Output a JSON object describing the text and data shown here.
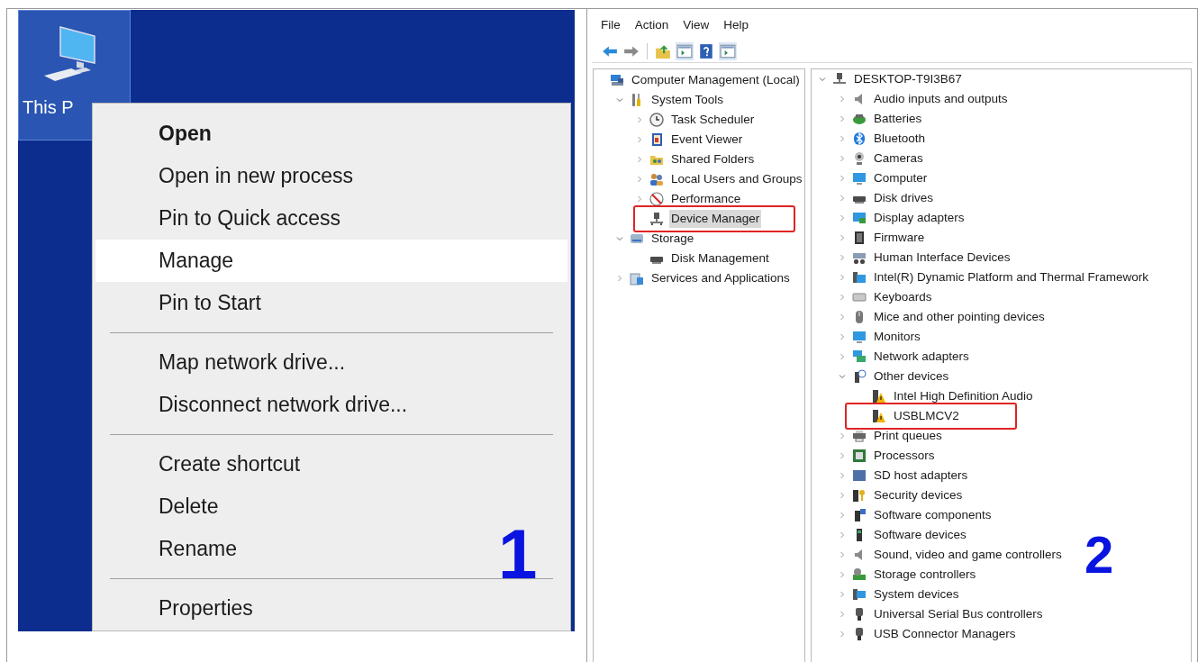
{
  "desktop": {
    "icon": {
      "label": "This P",
      "selected": true
    },
    "context_menu": {
      "groups": [
        [
          {
            "label": "Open",
            "default": true,
            "selected": false
          },
          {
            "label": "Open in new process",
            "default": false,
            "selected": false
          },
          {
            "label": "Pin to Quick access",
            "default": false,
            "selected": false
          },
          {
            "label": "Manage",
            "default": false,
            "selected": true
          },
          {
            "label": "Pin to Start",
            "default": false,
            "selected": false
          }
        ],
        [
          {
            "label": "Map network drive...",
            "default": false,
            "selected": false
          },
          {
            "label": "Disconnect network drive...",
            "default": false,
            "selected": false
          }
        ],
        [
          {
            "label": "Create shortcut",
            "default": false,
            "selected": false
          },
          {
            "label": "Delete",
            "default": false,
            "selected": false
          },
          {
            "label": "Rename",
            "default": false,
            "selected": false
          }
        ],
        [
          {
            "label": "Properties",
            "default": false,
            "selected": false
          }
        ]
      ]
    },
    "step_number": "1"
  },
  "computer_management": {
    "menu_bar": [
      "File",
      "Action",
      "View",
      "Help"
    ],
    "console_tree": [
      {
        "label": "Computer Management (Local)",
        "expandable": false,
        "selected": false,
        "highlighted": false,
        "children": [
          {
            "label": "System Tools",
            "expandable": true,
            "expanded": true,
            "selected": false,
            "highlighted": false,
            "children": [
              {
                "label": "Task Scheduler",
                "expandable": true,
                "expanded": false,
                "selected": false,
                "highlighted": false
              },
              {
                "label": "Event Viewer",
                "expandable": true,
                "expanded": false,
                "selected": false,
                "highlighted": false
              },
              {
                "label": "Shared Folders",
                "expandable": true,
                "expanded": false,
                "selected": false,
                "highlighted": false
              },
              {
                "label": "Local Users and Groups",
                "expandable": true,
                "expanded": false,
                "selected": false,
                "highlighted": false
              },
              {
                "label": "Performance",
                "expandable": true,
                "expanded": false,
                "selected": false,
                "highlighted": false
              },
              {
                "label": "Device Manager",
                "expandable": false,
                "selected": true,
                "highlighted": true
              }
            ]
          },
          {
            "label": "Storage",
            "expandable": true,
            "expanded": true,
            "selected": false,
            "highlighted": false,
            "children": [
              {
                "label": "Disk Management",
                "expandable": false,
                "selected": false,
                "highlighted": false
              }
            ]
          },
          {
            "label": "Services and Applications",
            "expandable": true,
            "expanded": false,
            "selected": false,
            "highlighted": false
          }
        ]
      }
    ],
    "device_tree": [
      {
        "label": "DESKTOP-T9I3B67",
        "expandable": true,
        "expanded": true,
        "highlighted": false,
        "children": [
          {
            "label": "Audio inputs and outputs",
            "expandable": true,
            "expanded": false,
            "highlighted": false
          },
          {
            "label": "Batteries",
            "expandable": true,
            "expanded": false,
            "highlighted": false
          },
          {
            "label": "Bluetooth",
            "expandable": true,
            "expanded": false,
            "highlighted": false
          },
          {
            "label": "Cameras",
            "expandable": true,
            "expanded": false,
            "highlighted": false
          },
          {
            "label": "Computer",
            "expandable": true,
            "expanded": false,
            "highlighted": false
          },
          {
            "label": "Disk drives",
            "expandable": true,
            "expanded": false,
            "highlighted": false
          },
          {
            "label": "Display adapters",
            "expandable": true,
            "expanded": false,
            "highlighted": false
          },
          {
            "label": "Firmware",
            "expandable": true,
            "expanded": false,
            "highlighted": false
          },
          {
            "label": "Human Interface Devices",
            "expandable": true,
            "expanded": false,
            "highlighted": false
          },
          {
            "label": "Intel(R) Dynamic Platform and Thermal Framework",
            "expandable": true,
            "expanded": false,
            "highlighted": false
          },
          {
            "label": "Keyboards",
            "expandable": true,
            "expanded": false,
            "highlighted": false
          },
          {
            "label": "Mice and other pointing devices",
            "expandable": true,
            "expanded": false,
            "highlighted": false
          },
          {
            "label": "Monitors",
            "expandable": true,
            "expanded": false,
            "highlighted": false
          },
          {
            "label": "Network adapters",
            "expandable": true,
            "expanded": false,
            "highlighted": false
          },
          {
            "label": "Other devices",
            "expandable": true,
            "expanded": true,
            "highlighted": false,
            "children": [
              {
                "label": "Intel High Definition Audio",
                "expandable": false,
                "highlighted": false
              },
              {
                "label": "USBLMCV2",
                "expandable": false,
                "highlighted": true
              }
            ]
          },
          {
            "label": "Print queues",
            "expandable": true,
            "expanded": false,
            "highlighted": false
          },
          {
            "label": "Processors",
            "expandable": true,
            "expanded": false,
            "highlighted": false
          },
          {
            "label": "SD host adapters",
            "expandable": true,
            "expanded": false,
            "highlighted": false
          },
          {
            "label": "Security devices",
            "expandable": true,
            "expanded": false,
            "highlighted": false
          },
          {
            "label": "Software components",
            "expandable": true,
            "expanded": false,
            "highlighted": false
          },
          {
            "label": "Software devices",
            "expandable": true,
            "expanded": false,
            "highlighted": false
          },
          {
            "label": "Sound, video and game controllers",
            "expandable": true,
            "expanded": false,
            "highlighted": false
          },
          {
            "label": "Storage controllers",
            "expandable": true,
            "expanded": false,
            "highlighted": false
          },
          {
            "label": "System devices",
            "expandable": true,
            "expanded": false,
            "highlighted": false
          },
          {
            "label": "Universal Serial Bus controllers",
            "expandable": true,
            "expanded": false,
            "highlighted": false
          },
          {
            "label": "USB Connector Managers",
            "expandable": true,
            "expanded": false,
            "highlighted": false
          }
        ]
      }
    ],
    "step_number": "2"
  }
}
